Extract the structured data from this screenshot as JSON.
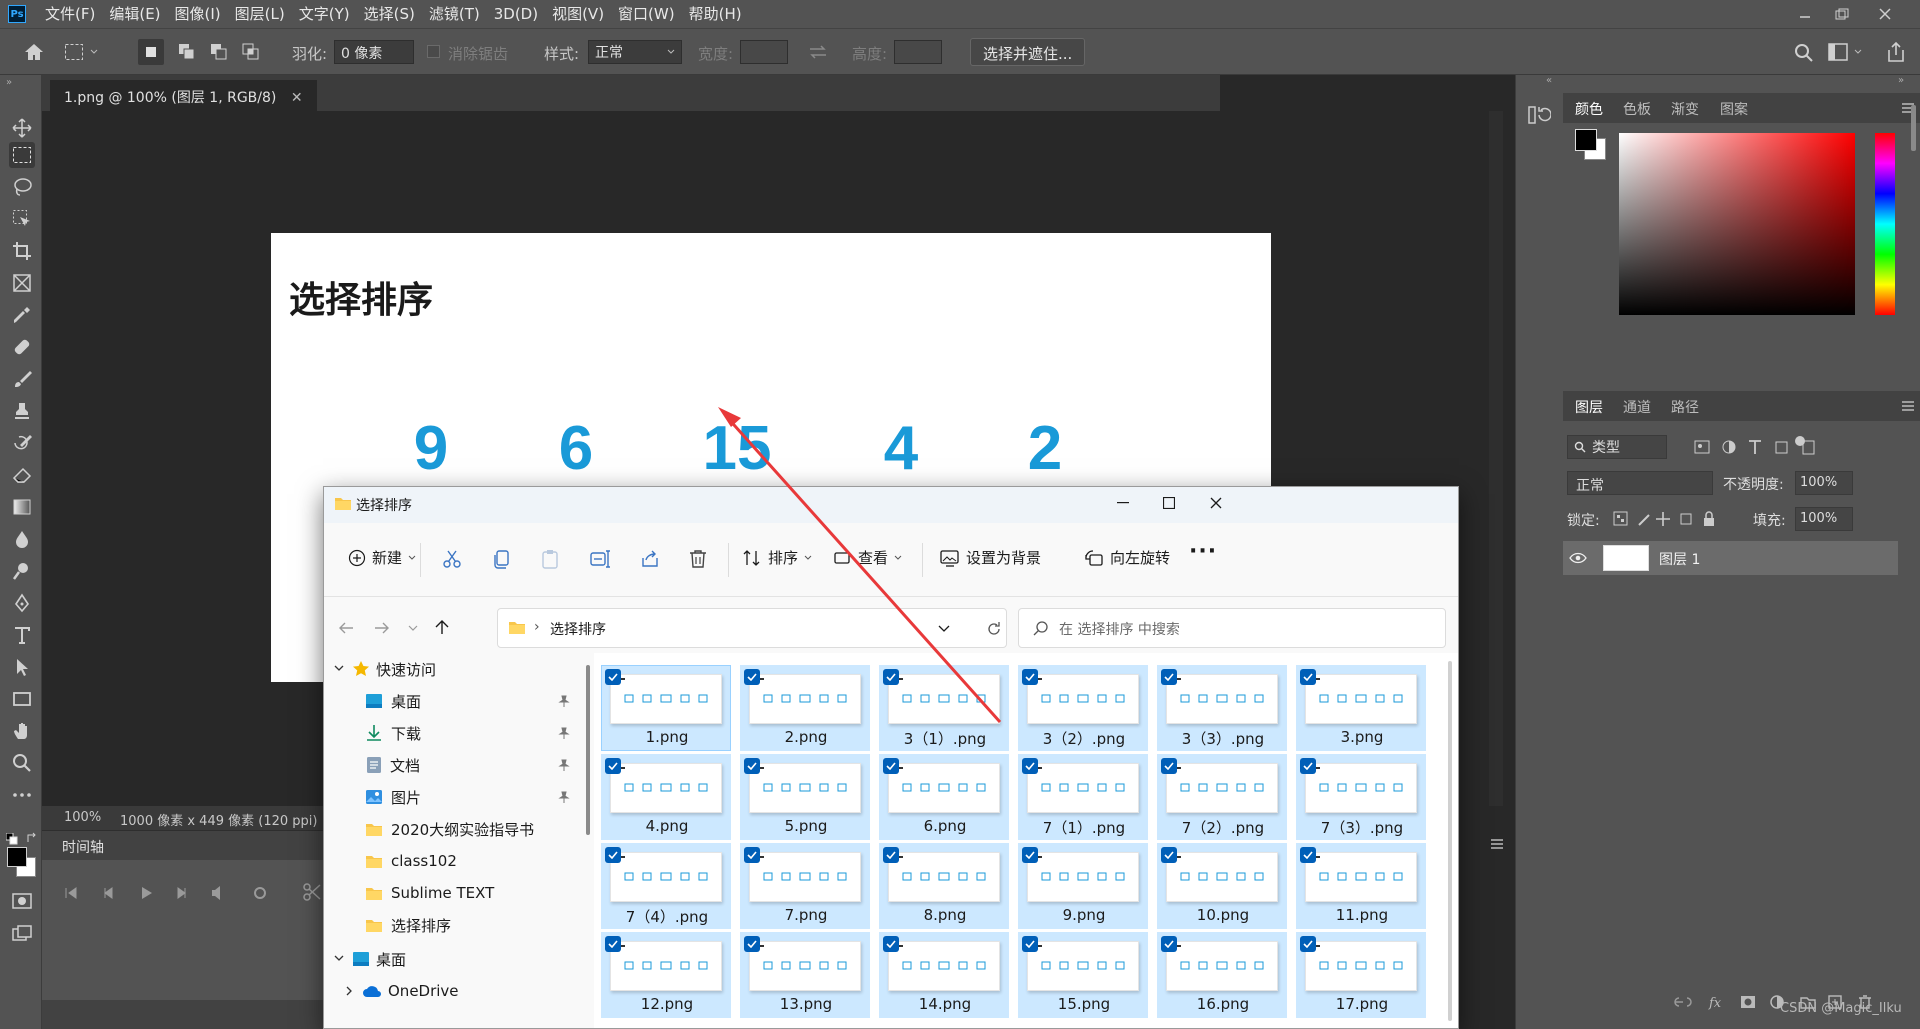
{
  "menubar": {
    "logo": "Ps",
    "items": [
      "文件(F)",
      "编辑(E)",
      "图像(I)",
      "图层(L)",
      "文字(Y)",
      "选择(S)",
      "滤镜(T)",
      "3D(D)",
      "视图(V)",
      "窗口(W)",
      "帮助(H)"
    ]
  },
  "options": {
    "feather_label": "羽化:",
    "feather_value": "0 像素",
    "antialias_label": "消除锯齿",
    "style_label": "样式:",
    "style_value": "正常",
    "width_label": "宽度:",
    "height_label": "高度:",
    "select_mask_button": "选择并遮住..."
  },
  "document": {
    "tab_title": "1.png @ 100% (图层 1, RGB/8)",
    "title": "选择排序",
    "numbers": [
      "9",
      "6",
      "15",
      "4",
      "2"
    ]
  },
  "status": {
    "zoom": "100%",
    "info": "1000 像素 x 449 像素 (120 ppi)"
  },
  "timeline": {
    "title": "时间轴"
  },
  "color_panel": {
    "tabs": [
      "颜色",
      "色板",
      "渐变",
      "图案"
    ],
    "fg": "#000000",
    "bg": "#ffffff",
    "field_hue": "#ff0000"
  },
  "layers_panel": {
    "tabs": [
      "图层",
      "通道",
      "路径"
    ],
    "filter_label": "类型",
    "blend_mode": "正常",
    "opacity_label": "不透明度:",
    "opacity_value": "100%",
    "lock_label": "锁定:",
    "fill_label": "填充:",
    "fill_value": "100%",
    "layer_name": "图层 1"
  },
  "explorer": {
    "title": "选择排序",
    "commands": {
      "new": "新建",
      "sort": "排序",
      "view": "查看",
      "set_background": "设置为背景",
      "rotate_left": "向左旋转",
      "more": "···"
    },
    "address": "选择排序",
    "search_placeholder": "在 选择排序 中搜索",
    "nav": {
      "quick_access": "快速访问",
      "items": [
        "桌面",
        "下载",
        "文档",
        "图片",
        "2020大纲实验指导书",
        "class102",
        "Sublime TEXT",
        "选择排序"
      ],
      "desktop": "桌面",
      "onedrive": "OneDrive"
    },
    "files": [
      "1.png",
      "2.png",
      "3（1）.png",
      "3（2）.png",
      "3（3）.png",
      "3.png",
      "4.png",
      "5.png",
      "6.png",
      "7（1）.png",
      "7（2）.png",
      "7（3）.png",
      "7（4）.png",
      "7.png",
      "8.png",
      "9.png",
      "10.png",
      "11.png",
      "12.png",
      "13.png",
      "14.png",
      "15.png",
      "16.png",
      "17.png"
    ]
  },
  "watermark": "CSDN @Magic_Ilku"
}
